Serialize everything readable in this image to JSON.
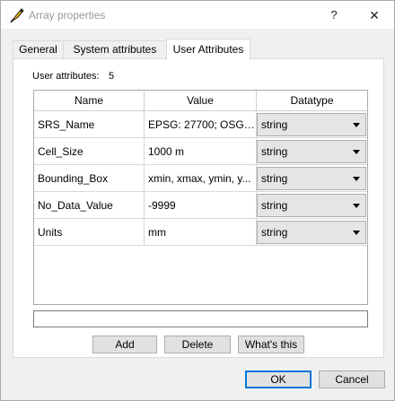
{
  "window": {
    "title": "Array properties",
    "help_glyph": "?",
    "close_glyph": "✕"
  },
  "tabs": [
    {
      "label": "General"
    },
    {
      "label": "System attributes"
    },
    {
      "label": "User Attributes"
    }
  ],
  "user_attributes": {
    "count_label": "User attributes:",
    "count_value": "5",
    "columns": [
      "Name",
      "Value",
      "Datatype"
    ],
    "rows": [
      {
        "name": "SRS_Name",
        "value": "EPSG: 27700; OSGB ...",
        "datatype": "string"
      },
      {
        "name": "Cell_Size",
        "value": "1000 m",
        "datatype": "string"
      },
      {
        "name": "Bounding_Box",
        "value": "xmin, xmax, ymin, y...",
        "datatype": "string"
      },
      {
        "name": "No_Data_Value",
        "value": "-9999",
        "datatype": "string"
      },
      {
        "name": "Units",
        "value": "mm",
        "datatype": "string"
      }
    ],
    "description_text": "",
    "buttons": {
      "add": "Add",
      "delete": "Delete",
      "whats_this": "What's this"
    }
  },
  "footer": {
    "ok": "OK",
    "cancel": "Cancel"
  },
  "colors": {
    "focus_border": "#0078d7",
    "title_inactive": "#999999"
  },
  "icons": {
    "app": "python-feather-icon",
    "combo": "chevron-down-icon"
  }
}
